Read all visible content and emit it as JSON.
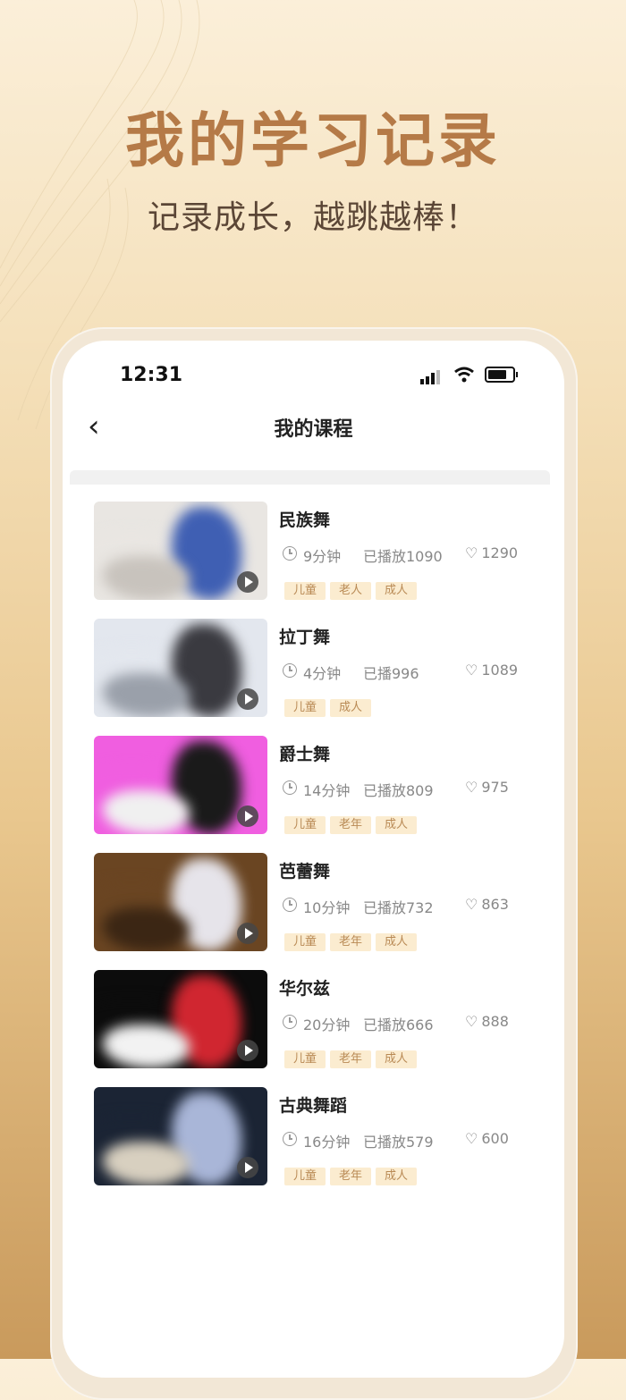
{
  "promo": {
    "title": "我的学习记录",
    "subtitle": "记录成长，越跳越棒！"
  },
  "status_bar": {
    "time": "12:31",
    "icons": [
      "signal-icon",
      "wifi-icon",
      "battery-icon"
    ]
  },
  "nav": {
    "back_icon": "chevron-left-icon",
    "title": "我的课程"
  },
  "courses": [
    {
      "title": "民族舞",
      "duration": "9分钟",
      "plays": "已播放1090",
      "likes": "1290",
      "tags": [
        "儿童",
        "老人",
        "成人"
      ],
      "thumb_colors": [
        "#e9e6e2",
        "#3f5fb3",
        "#c8c3bd"
      ]
    },
    {
      "title": "拉丁舞",
      "duration": "4分钟",
      "plays": "已播996",
      "likes": "1089",
      "tags": [
        "儿童",
        "成人"
      ],
      "thumb_colors": [
        "#e3e7ee",
        "#3a3a40",
        "#9aa0aa"
      ]
    },
    {
      "title": "爵士舞",
      "duration": "14分钟",
      "plays": "已播放809",
      "likes": "975",
      "tags": [
        "儿童",
        "老年",
        "成人"
      ],
      "thumb_colors": [
        "#f05ee0",
        "#1a1a1a",
        "#f0f0f0"
      ]
    },
    {
      "title": "芭蕾舞",
      "duration": "10分钟",
      "plays": "已播放732",
      "likes": "863",
      "tags": [
        "儿童",
        "老年",
        "成人"
      ],
      "thumb_colors": [
        "#6a4522",
        "#e6e4ea",
        "#3b2614"
      ]
    },
    {
      "title": "华尔兹",
      "duration": "20分钟",
      "plays": "已播放666",
      "likes": "888",
      "tags": [
        "儿童",
        "老年",
        "成人"
      ],
      "thumb_colors": [
        "#0c0c0c",
        "#d02630",
        "#f2f2f2"
      ]
    },
    {
      "title": "古典舞蹈",
      "duration": "16分钟",
      "plays": "已播放579",
      "likes": "600",
      "tags": [
        "儿童",
        "老年",
        "成人"
      ],
      "thumb_colors": [
        "#1b2434",
        "#a9b6d8",
        "#d8d0c0"
      ]
    }
  ],
  "colors": {
    "accent_title": "#b57a47",
    "tag_bg": "#fbecd0",
    "tag_text": "#b98a55"
  }
}
